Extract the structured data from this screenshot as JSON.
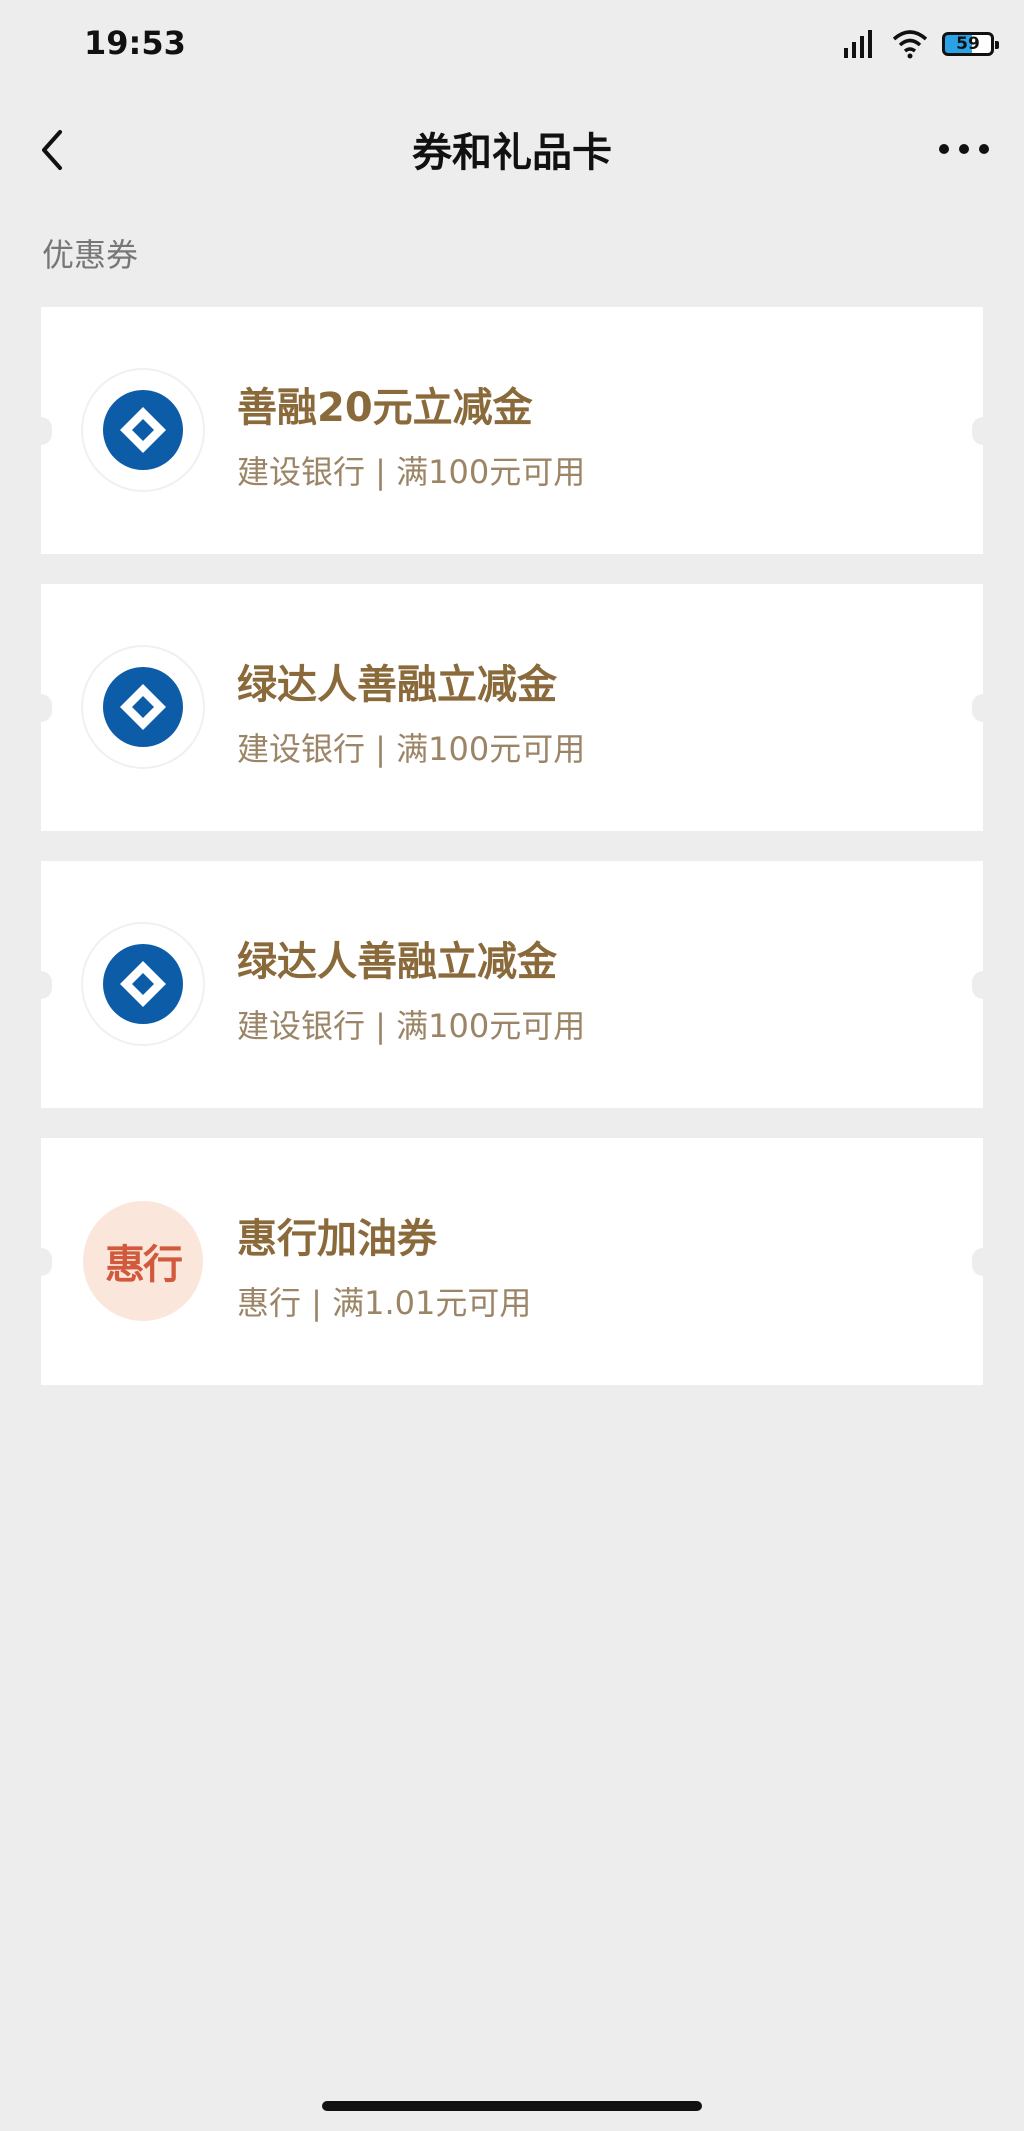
{
  "status_bar": {
    "time": "19:53",
    "battery": "59"
  },
  "nav": {
    "title": "券和礼品卡"
  },
  "section": {
    "title": "优惠券"
  },
  "coupons": [
    {
      "title": "善融20元立减金",
      "subtitle": "建设银行 | 满100元可用",
      "logo": "ccb-logo-icon"
    },
    {
      "title": "绿达人善融立减金",
      "subtitle": "建设银行 | 满100元可用",
      "logo": "ccb-logo-icon"
    },
    {
      "title": "绿达人善融立减金",
      "subtitle": "建设银行 | 满100元可用",
      "logo": "ccb-logo-icon"
    },
    {
      "title": "惠行加油券",
      "subtitle": "惠行 | 满1.01元可用",
      "logo": "huixing-logo-icon",
      "logo_text": "惠行"
    }
  ],
  "colors": {
    "background": "#ededed",
    "coupon_title": "#8a6a3b",
    "coupon_subtitle": "#9b8566",
    "ccb_blue": "#0d5ca8",
    "huixing_red": "#d25a3c"
  }
}
